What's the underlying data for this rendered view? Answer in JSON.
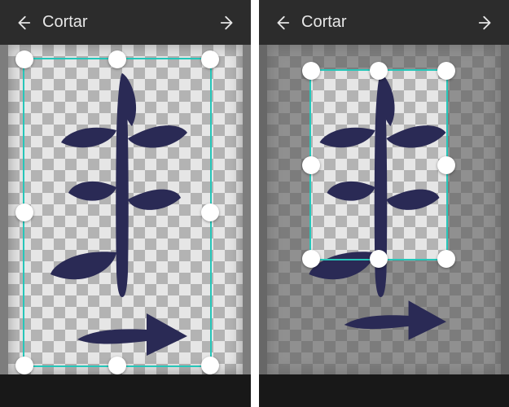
{
  "topbar": {
    "title": "Cortar",
    "back_icon": "arrow-left",
    "next_icon": "arrow-right"
  },
  "crop": {
    "accent_color": "#26c6b9",
    "handle_color": "#ffffff",
    "left_panel": {
      "checker_visible": true,
      "crop_rect_note": "full-image crop, handles at all 8 positions"
    },
    "right_panel": {
      "checker_visible": true,
      "crop_rect_note": "smaller crop around plant only, dimmed outside"
    }
  },
  "artwork": {
    "description": "dark navy plant sprig + arrow doodle on transparent checkerboard",
    "ink_color": "#2a2a55"
  }
}
